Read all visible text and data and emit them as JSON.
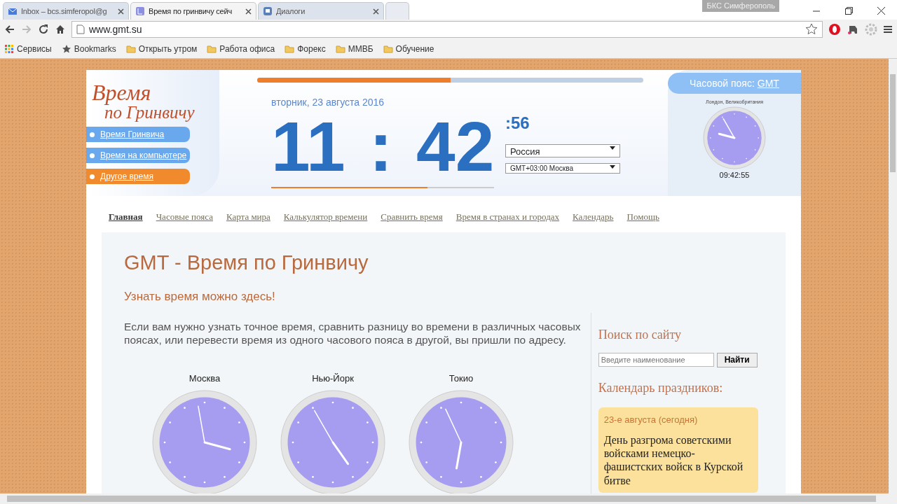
{
  "browser": {
    "tabs": [
      {
        "label": "Inbox – bcs.simferopol@g",
        "kind": "mail",
        "selected": false
      },
      {
        "label": "Время по гринвичу сейч",
        "kind": "page",
        "selected": true
      },
      {
        "label": "Диалоги",
        "kind": "chat",
        "selected": false
      }
    ],
    "profile": "БКС Симферополь",
    "address": "www.gmt.su",
    "bookmarks": [
      {
        "label": "Сервисы",
        "kind": "apps"
      },
      {
        "label": "Bookmarks",
        "kind": "star"
      },
      {
        "label": "Открыть утром",
        "kind": "folder"
      },
      {
        "label": "Работа офиса",
        "kind": "folder"
      },
      {
        "label": "Форекс",
        "kind": "folder"
      },
      {
        "label": "ММВБ",
        "kind": "folder"
      },
      {
        "label": "Обучение",
        "kind": "folder"
      }
    ]
  },
  "header": {
    "logo_line1": "Время",
    "logo_line2": "по Гринвичу",
    "menu": [
      {
        "label": "Время Гринвича",
        "color": "#6aa8ee"
      },
      {
        "label": "Время на компьютере",
        "color": "#6aa8ee"
      },
      {
        "label": "Другое время",
        "color": "#f08a2c"
      }
    ],
    "progress": {
      "level": 0.5
    },
    "date": "вторник, 23 августа 2016",
    "hours": "11",
    "separator": ":",
    "minutes": "42",
    "seconds": ":56",
    "seconds_bar": {
      "level": 0.7
    },
    "country": "Россия",
    "zone": "GMT+03:00 Москва",
    "tz_label": "Часовой пояс:",
    "tz_link": "GMT",
    "tz_city": "Лондон, Великобритания",
    "tz_time": "09:42:55"
  },
  "nav": [
    {
      "label": "Главная",
      "selected": true
    },
    {
      "label": "Часовые пояса",
      "selected": false
    },
    {
      "label": "Карта мира",
      "selected": false
    },
    {
      "label": "Калькулятор времени",
      "selected": false
    },
    {
      "label": "Сравнить время",
      "selected": false
    },
    {
      "label": "Время в странах и городах",
      "selected": false
    },
    {
      "label": "Календарь",
      "selected": false
    },
    {
      "label": "Помощь",
      "selected": false
    }
  ],
  "content": {
    "title": "GMT - Время по Гринвичу",
    "subtitle": "Узнать время можно здесь!",
    "intro": "Если  вам нужно узнать точное время, сравнить разницу во времени в различных часовых поясах, или перевести время из одного часового пояса в другой, вы пришли по адресу.",
    "clocks": [
      {
        "city": "Москва"
      },
      {
        "city": "Нью-Йорк"
      },
      {
        "city": "Токио"
      }
    ]
  },
  "sidebar": {
    "search_title": "Поиск по сайту",
    "search_placeholder": "Введите наименование",
    "search_button": "Найти",
    "holidays_title": "Календарь праздников:",
    "holiday_date": "23-е августа (сегодня)",
    "holiday_text": "День разгрома советскими войсками немецко-фашистских войск в Курской битве"
  }
}
